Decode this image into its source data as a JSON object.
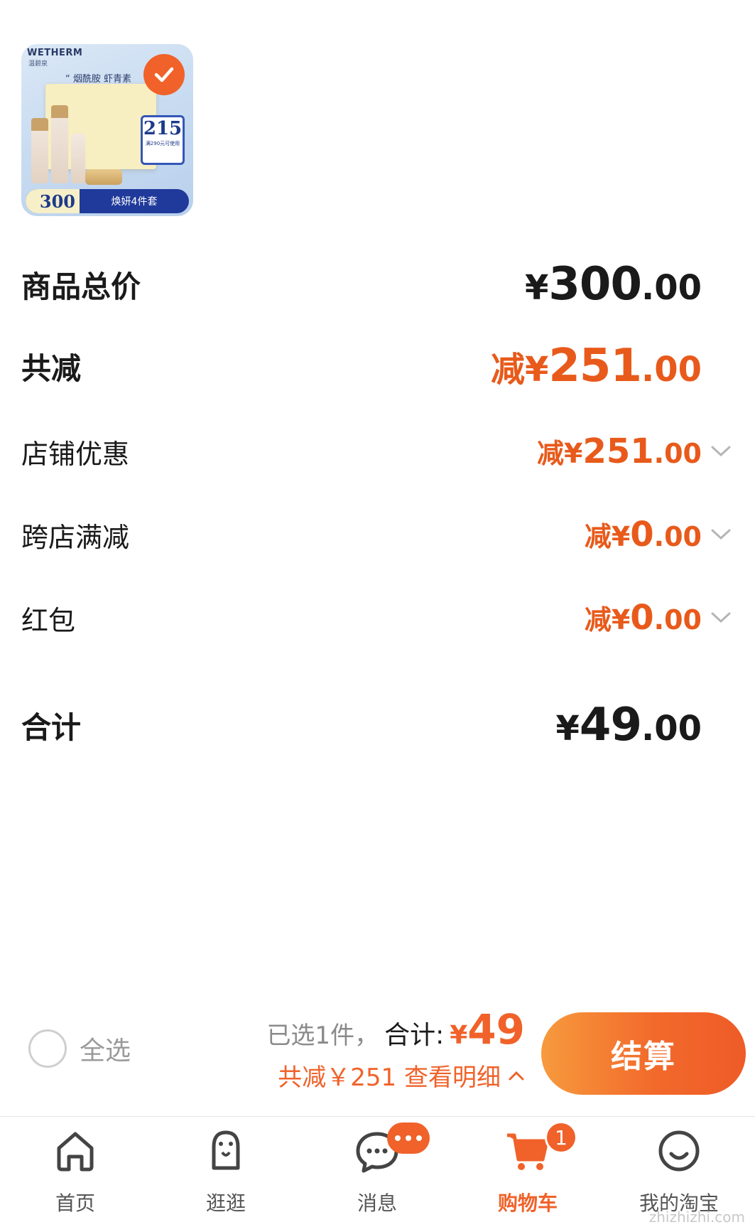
{
  "product": {
    "brand": "WETHERM",
    "brand_sub": "温碧泉",
    "slogan": "“ 烟酰胺 虾青素",
    "coupon_amount": "215",
    "coupon_sub": "满290元可使用",
    "price_tag": "300",
    "bundle_name": "焕妍4件套",
    "selected": true
  },
  "summary_rows": {
    "goods_total": {
      "label": "商品总价",
      "currency": "¥",
      "int": "300",
      "dec": ".00"
    },
    "total_discount": {
      "label": "共减",
      "prefix": "减¥",
      "int": "251",
      "dec": ".00"
    },
    "shop_discount": {
      "label": "店铺优惠",
      "prefix": "减¥",
      "int": "251",
      "dec": ".00"
    },
    "cross_shop": {
      "label": "跨店满减",
      "prefix": "减¥",
      "int": "0",
      "dec": ".00"
    },
    "red_packet": {
      "label": "红包",
      "prefix": "减¥",
      "int": "0",
      "dec": ".00"
    },
    "grand_total": {
      "label": "合计",
      "currency": "¥",
      "int": "49",
      "dec": ".00"
    }
  },
  "action_bar": {
    "select_all": "全选",
    "picked": "已选1件，",
    "total_label": "合计:",
    "total_currency": "¥",
    "total_amount": "49",
    "discount_detail": "共减￥251 查看明细",
    "checkout": "结算"
  },
  "tabs": [
    {
      "label": "首页",
      "icon": "home-icon"
    },
    {
      "label": "逛逛",
      "icon": "explore-icon"
    },
    {
      "label": "消息",
      "icon": "message-icon"
    },
    {
      "label": "购物车",
      "icon": "cart-icon",
      "badge": "1",
      "active": true
    },
    {
      "label": "我的淘宝",
      "icon": "profile-icon"
    }
  ],
  "watermark": "zhizhizhi.com",
  "colors": {
    "accent": "#f0622a",
    "discount": "#e85a1b",
    "text": "#1a1a1a"
  }
}
